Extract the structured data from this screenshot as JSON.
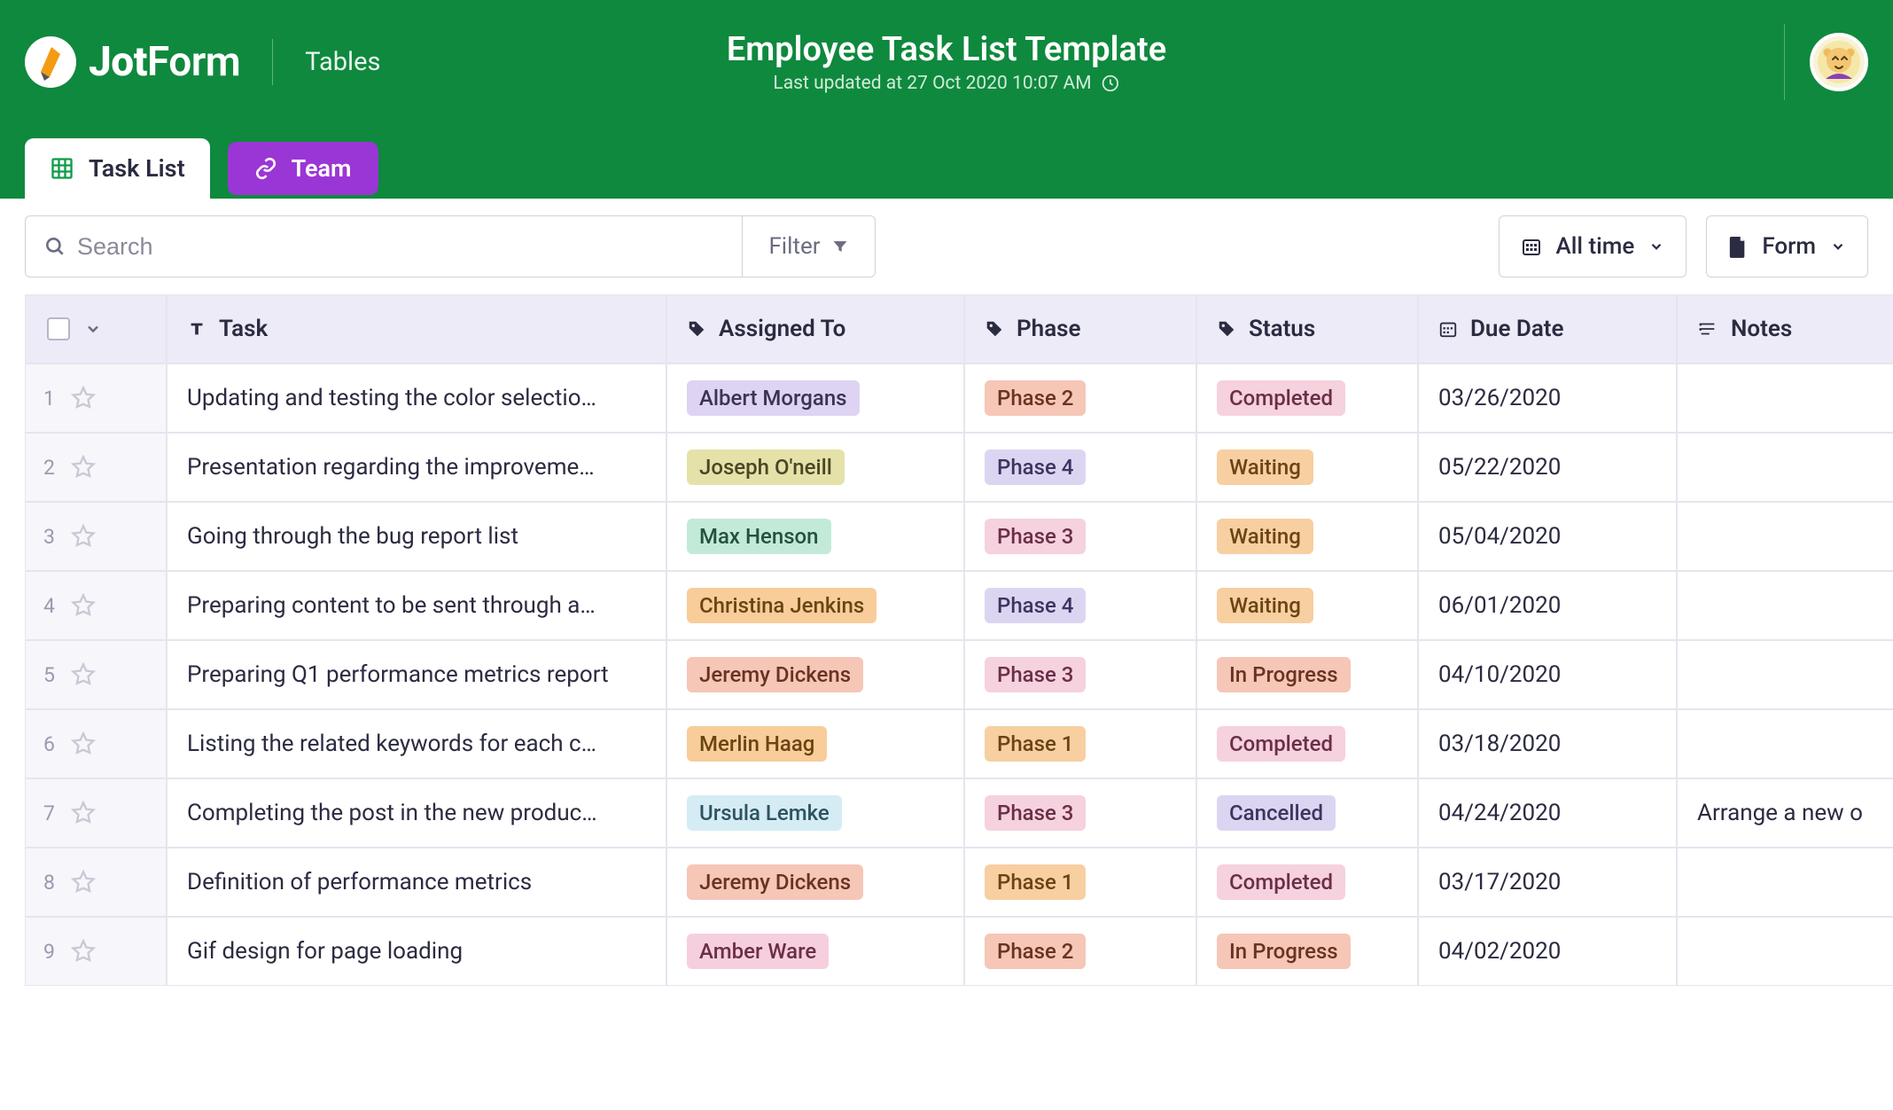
{
  "header": {
    "brand": "JotForm",
    "section": "Tables",
    "title": "Employee Task List Template",
    "subtitle": "Last updated at 27 Oct 2020 10:07 AM"
  },
  "tabs": {
    "task_list": "Task List",
    "team": "Team"
  },
  "toolbar": {
    "search_placeholder": "Search",
    "filter": "Filter",
    "time_range": "All time",
    "form": "Form"
  },
  "columns": {
    "task": "Task",
    "assigned_to": "Assigned To",
    "phase": "Phase",
    "status": "Status",
    "due_date": "Due Date",
    "notes": "Notes"
  },
  "pill_colors": {
    "assignee": {
      "Albert Morgans": "c-lav",
      "Joseph O'neill": "c-olive",
      "Max Henson": "c-mint",
      "Christina Jenkins": "c-orange",
      "Jeremy Dickens": "c-salmon",
      "Merlin Haag": "c-orange",
      "Ursula Lemke": "c-ice",
      "Amber Ware": "c-pink"
    },
    "phase": {
      "Phase 1": "c-peach",
      "Phase 2": "c-salmon",
      "Phase 3": "c-rosy",
      "Phase 4": "c-lilac"
    },
    "status": {
      "Completed": "c-rosy",
      "Waiting": "c-peach",
      "In Progress": "c-salmon",
      "Cancelled": "c-lilac"
    }
  },
  "rows": [
    {
      "num": "1",
      "task": "Updating and testing the color selectio…",
      "assignee": "Albert Morgans",
      "phase": "Phase 2",
      "status": "Completed",
      "due": "03/26/2020",
      "notes": ""
    },
    {
      "num": "2",
      "task": "Presentation regarding the improveme…",
      "assignee": "Joseph O'neill",
      "phase": "Phase 4",
      "status": "Waiting",
      "due": "05/22/2020",
      "notes": ""
    },
    {
      "num": "3",
      "task": "Going through the bug report list",
      "assignee": "Max Henson",
      "phase": "Phase 3",
      "status": "Waiting",
      "due": "05/04/2020",
      "notes": ""
    },
    {
      "num": "4",
      "task": "Preparing content to be sent through a…",
      "assignee": "Christina Jenkins",
      "phase": "Phase 4",
      "status": "Waiting",
      "due": "06/01/2020",
      "notes": ""
    },
    {
      "num": "5",
      "task": "Preparing Q1 performance metrics report",
      "assignee": "Jeremy Dickens",
      "phase": "Phase 3",
      "status": "In Progress",
      "due": "04/10/2020",
      "notes": ""
    },
    {
      "num": "6",
      "task": "Listing the related keywords for each c…",
      "assignee": "Merlin Haag",
      "phase": "Phase 1",
      "status": "Completed",
      "due": "03/18/2020",
      "notes": ""
    },
    {
      "num": "7",
      "task": "Completing the post in the new produc…",
      "assignee": "Ursula Lemke",
      "phase": "Phase 3",
      "status": "Cancelled",
      "due": "04/24/2020",
      "notes": "Arrange a new o"
    },
    {
      "num": "8",
      "task": "Definition of performance metrics",
      "assignee": "Jeremy Dickens",
      "phase": "Phase 1",
      "status": "Completed",
      "due": "03/17/2020",
      "notes": ""
    },
    {
      "num": "9",
      "task": "Gif design for page loading",
      "assignee": "Amber Ware",
      "phase": "Phase 2",
      "status": "In Progress",
      "due": "04/02/2020",
      "notes": ""
    }
  ]
}
